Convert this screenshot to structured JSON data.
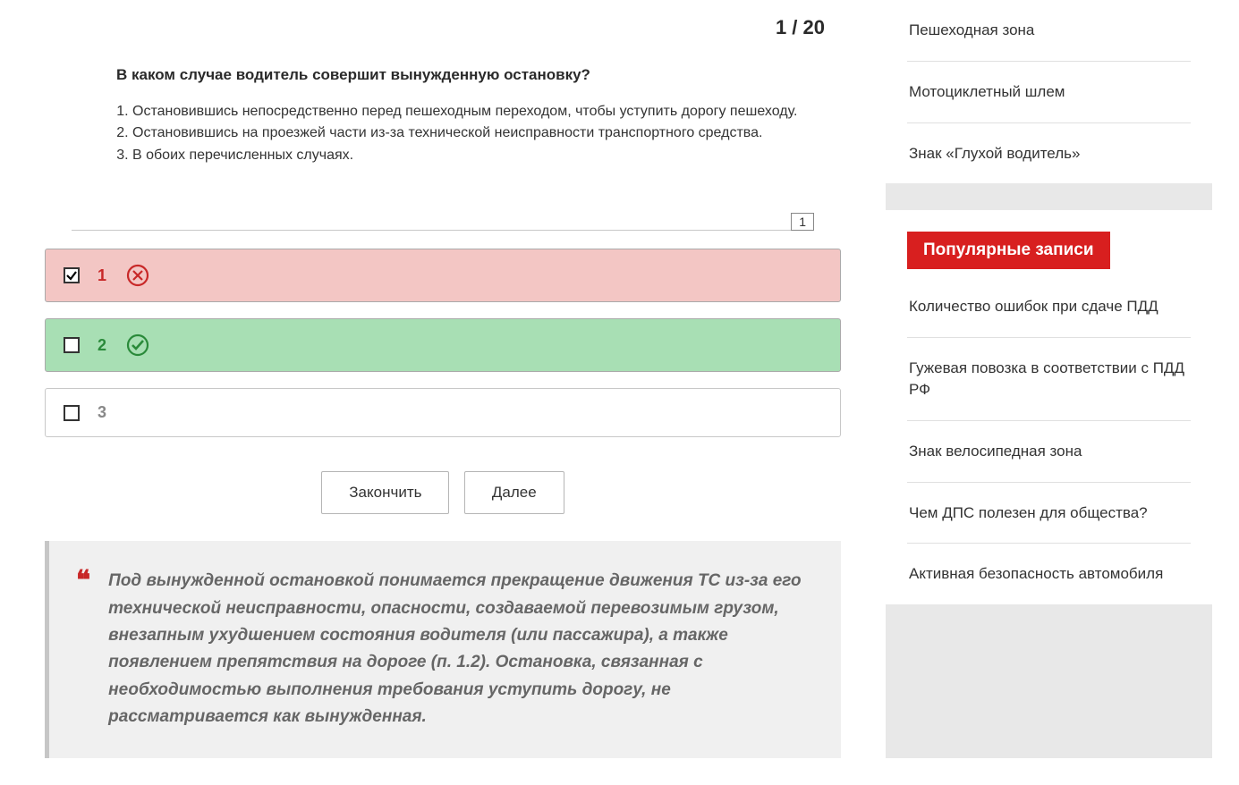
{
  "progress": {
    "current": "1",
    "total": "20",
    "display": "1 / 20"
  },
  "question": {
    "title": "В каком случае водитель совершит вынужденную остановку?",
    "options": [
      "Остановившись непосредственно перед пешеходным переходом, чтобы уступить дорогу пешеходу.",
      "Остановившись на проезжей части из-за технической неисправности транспортного средства.",
      "В обоих перечисленных случаях."
    ],
    "page_badge": "1"
  },
  "answers": {
    "opt1": {
      "num": "1",
      "state": "wrong",
      "checked": true
    },
    "opt2": {
      "num": "2",
      "state": "correct",
      "checked": false
    },
    "opt3": {
      "num": "3",
      "state": "plain",
      "checked": false
    }
  },
  "buttons": {
    "finish": "Закончить",
    "next": "Далее"
  },
  "explanation": "Под вынужденной остановкой понимается прекращение движения ТС из-за его технической неисправности, опасности, создаваемой перевозимым грузом, внезапным ухудшением состояния водителя (или пассажира), а также появлением препятствия на дороге (п. 1.2). Остановка, связанная с необходимостью выполнения требования уступить дорогу, не рассматривается как вынужденная.",
  "sidebar": {
    "top_list": [
      "Пешеходная зона",
      "Мотоциклетный шлем",
      "Знак «Глухой водитель»"
    ],
    "popular": {
      "title": "Популярные записи",
      "items": [
        "Количество ошибок при сдаче ПДД",
        "Гужевая повозка в соответствии с ПДД РФ",
        "Знак велосипедная зона",
        "Чем ДПС полезен для общества?",
        "Активная безопасность автомобиля"
      ]
    }
  }
}
